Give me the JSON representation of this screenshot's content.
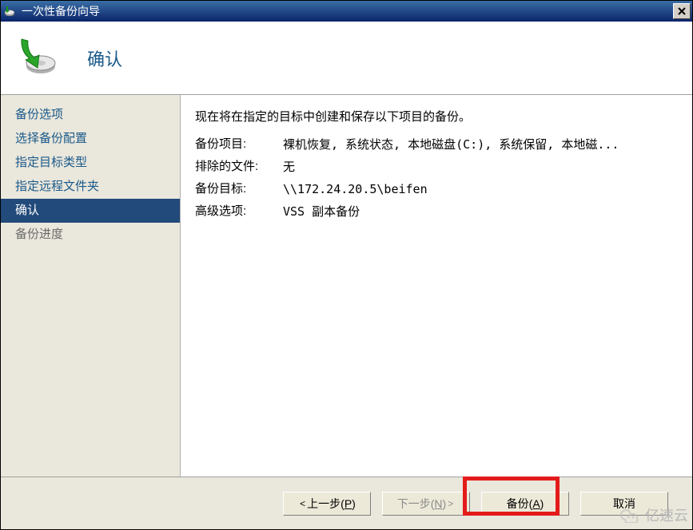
{
  "window": {
    "title": "一次性备份向导",
    "close_label": "✕"
  },
  "header": {
    "title": "确认"
  },
  "sidebar": {
    "items": [
      {
        "label": "备份选项",
        "active": false,
        "muted": false
      },
      {
        "label": "选择备份配置",
        "active": false,
        "muted": false
      },
      {
        "label": "指定目标类型",
        "active": false,
        "muted": false
      },
      {
        "label": "指定远程文件夹",
        "active": false,
        "muted": false
      },
      {
        "label": "确认",
        "active": true,
        "muted": false
      },
      {
        "label": "备份进度",
        "active": false,
        "muted": true
      }
    ]
  },
  "content": {
    "intro": "现在将在指定的目标中创建和保存以下项目的备份。",
    "rows": [
      {
        "label": "备份项目:",
        "value": "裸机恢复, 系统状态, 本地磁盘(C:), 系统保留, 本地磁..."
      },
      {
        "label": "排除的文件:",
        "value": "无"
      },
      {
        "label": "备份目标:",
        "value": "\\\\172.24.20.5\\beifen"
      },
      {
        "label": "高级选项:",
        "value": "VSS 副本备份"
      }
    ]
  },
  "footer": {
    "prev_prefix": "上一步(",
    "prev_key": "P",
    "prev_suffix": ")",
    "next_prefix": "下一步(",
    "next_key": "N",
    "next_suffix": ")",
    "backup_prefix": "备份(",
    "backup_key": "A",
    "backup_suffix": ")",
    "cancel": "取消"
  },
  "watermark": {
    "text": "亿速云"
  }
}
